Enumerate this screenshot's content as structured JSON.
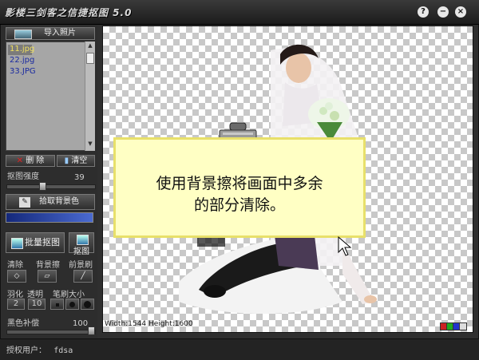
{
  "app": {
    "title": "影楼三剑客之信捷抠图  5.0",
    "help_icon": "help-icon",
    "minimize_icon": "minimize-icon",
    "close_icon": "close-icon"
  },
  "sidebar": {
    "import_label": "导入照片",
    "files": [
      "11.jpg",
      "22.jpg",
      "33.JPG"
    ],
    "delete_label": "删 除",
    "clear_label": "清空",
    "strength_label": "抠图强度",
    "strength_value": "39",
    "pick_bg_label": "拾取背景色",
    "bg_color": "#1f3a9c",
    "batch_label": "批量抠图",
    "cut_label": "抠图",
    "tools": [
      "清除",
      "背景擦",
      "前景刷"
    ],
    "feather_label": "羽化",
    "feather_value": "2",
    "transparency_label": "透明",
    "transparency_value": "10",
    "brush_size_label": "笔刷大小",
    "black_comp_label": "黑色补偿",
    "black_comp_value": "100"
  },
  "canvas": {
    "note_text_line1": "使用背景擦将画面中多余",
    "note_text_line2": "的部分清除。",
    "dimensions_text": "Width:1544  Height:1600",
    "swatches": [
      "#cc2222",
      "#22aa22",
      "#2233cc",
      "#dddddd"
    ]
  },
  "status": {
    "label": "授权用户：",
    "user": "fdsa"
  }
}
